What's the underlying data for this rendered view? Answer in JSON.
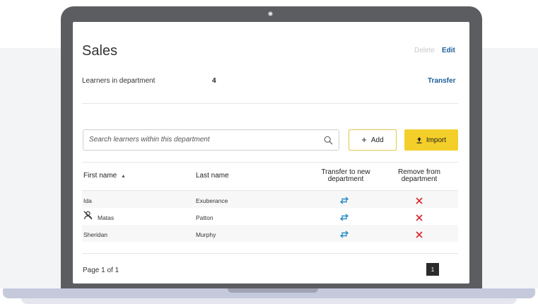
{
  "page": {
    "title": "Sales",
    "actions": {
      "delete_label": "Delete",
      "edit_label": "Edit"
    },
    "learners": {
      "label": "Learners in department",
      "count": "4",
      "transfer_label": "Transfer"
    }
  },
  "search": {
    "placeholder": "Search learners within this department",
    "value": ""
  },
  "buttons": {
    "add_label": "Add",
    "import_label": "Import"
  },
  "table": {
    "headers": {
      "first_name": "First name",
      "last_name": "Last name",
      "transfer_line1": "Transfer to new",
      "transfer_line2": "department",
      "remove_line1": "Remove from",
      "remove_line2": "department"
    },
    "sort": {
      "column": "first_name",
      "direction": "ascending"
    },
    "rows": [
      {
        "first_name": "Ida",
        "last_name": "Exuberance",
        "status_icon": ""
      },
      {
        "first_name": "Matas",
        "last_name": "Patton",
        "status_icon": "user-disabled-icon"
      },
      {
        "first_name": "Sheridan",
        "last_name": "Murphy",
        "status_icon": ""
      }
    ]
  },
  "pagination": {
    "label": "Page 1 of 1",
    "current": "1"
  },
  "colors": {
    "accent_yellow": "#f4cf2a",
    "link_blue": "#1d5e9a",
    "transfer_icon": "#2a8bc4",
    "remove_icon": "#d9262c"
  }
}
